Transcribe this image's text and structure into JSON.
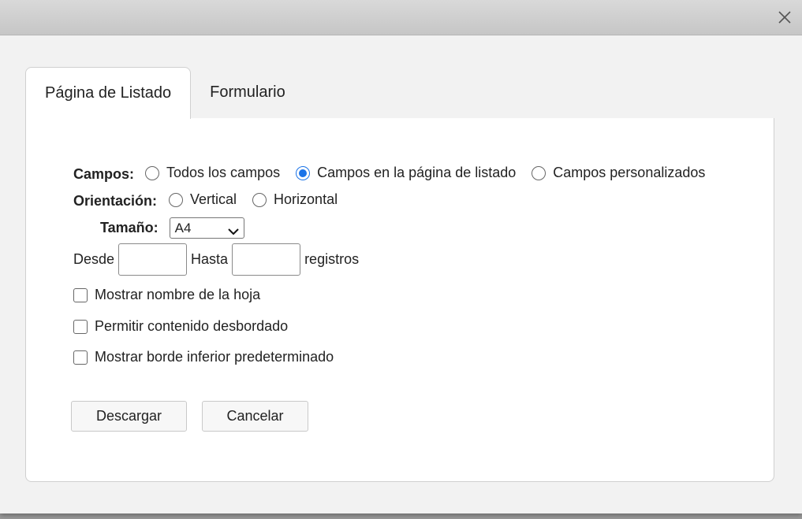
{
  "tabs": [
    {
      "label": "Página de Listado",
      "active": true
    },
    {
      "label": "Formulario",
      "active": false
    }
  ],
  "fields": {
    "label": "Campos:",
    "options": [
      "Todos los campos",
      "Campos en la página de listado",
      "Campos personalizados"
    ],
    "selected_index": 1
  },
  "orientation": {
    "label": "Orientación:",
    "options": [
      "Vertical",
      "Horizontal"
    ],
    "selected_index": -1
  },
  "size": {
    "label": "Tamaño:",
    "value": "A4"
  },
  "range": {
    "from_label": "Desde",
    "to_label": "Hasta",
    "unit_label": "registros",
    "from_value": "",
    "to_value": ""
  },
  "checkboxes": [
    {
      "label": "Mostrar nombre de la hoja",
      "checked": false
    },
    {
      "label": "Permitir contenido desbordado",
      "checked": false
    },
    {
      "label": "Mostrar borde inferior predeterminado",
      "checked": false
    }
  ],
  "buttons": {
    "download": "Descargar",
    "cancel": "Cancelar"
  },
  "colors": {
    "accent": "#1a73e8"
  }
}
